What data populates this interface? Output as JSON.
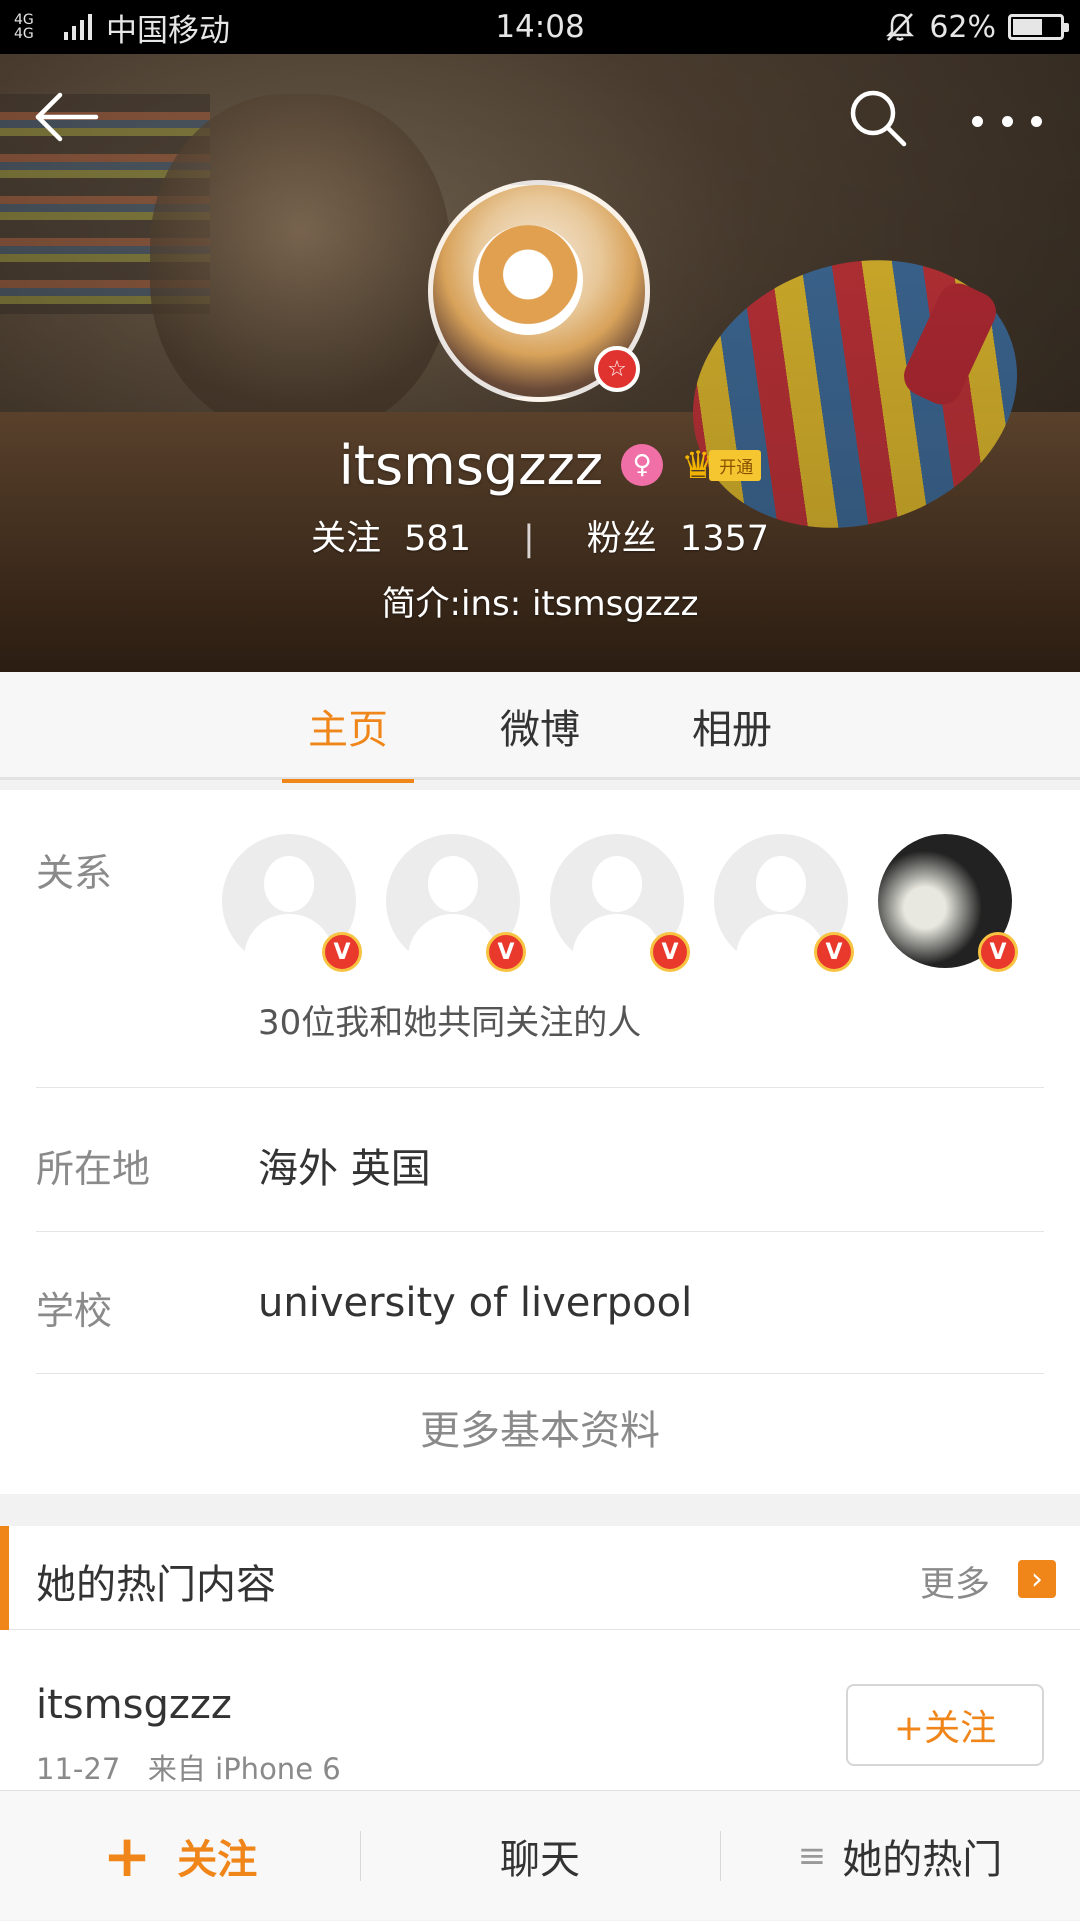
{
  "status_bar": {
    "network": "4G 4G",
    "carrier": "中国移动",
    "time": "14:08",
    "battery": "62%",
    "battery_level": 0.62
  },
  "header": {
    "back_icon": "back-arrow-icon",
    "search_icon": "search-icon",
    "more_icon": "more-dots-icon"
  },
  "profile": {
    "username": "itsmsgzzz",
    "gender_icon": "♀",
    "vip_label": "开通",
    "following_label": "关注",
    "following_count": "581",
    "followers_label": "粉丝",
    "followers_count": "1357",
    "bio": "简介:ins: itsmsgzzz"
  },
  "tabs": [
    {
      "label": "主页",
      "active": true
    },
    {
      "label": "微博",
      "active": false
    },
    {
      "label": "相册",
      "active": false
    }
  ],
  "info": {
    "relation_label": "关系",
    "common_follow_text": "30位我和她共同关注的人",
    "location_label": "所在地",
    "location_value": "海外 英国",
    "school_label": "学校",
    "school_value": "university of liverpool",
    "more_info": "更多基本资料"
  },
  "hot": {
    "title": "她的热门内容",
    "more": "更多"
  },
  "post": {
    "username": "itsmsgzzz",
    "meta": "11-27   来自 iPhone 6",
    "follow_button": "+关注"
  },
  "bottom_bar": {
    "follow": "关注",
    "chat": "聊天",
    "hot": "她的热门"
  },
  "colors": {
    "accent": "#f08519",
    "verified_badge": "#e8392c"
  }
}
